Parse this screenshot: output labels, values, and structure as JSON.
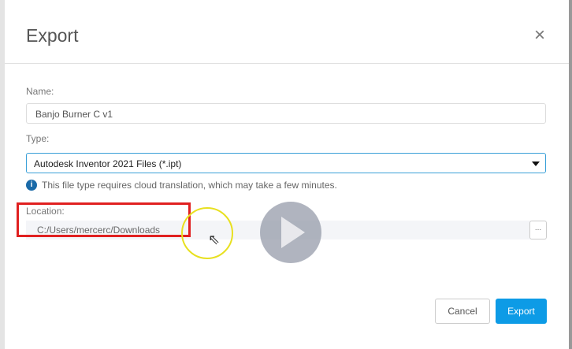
{
  "dialog": {
    "title": "Export",
    "close_icon": "×"
  },
  "form": {
    "name_label": "Name:",
    "name_value": "Banjo Burner C v1",
    "type_label": "Type:",
    "type_value": "Autodesk Inventor 2021 Files (*.ipt)",
    "info_text": "This file type requires cloud translation, which may take a few minutes.",
    "location_label": "Location:",
    "location_value": "C:/Users/mercerc/Downloads",
    "browse_label": "..."
  },
  "buttons": {
    "cancel": "Cancel",
    "export": "Export"
  },
  "colors": {
    "accent": "#0d9be6",
    "highlight": "#e02020"
  }
}
